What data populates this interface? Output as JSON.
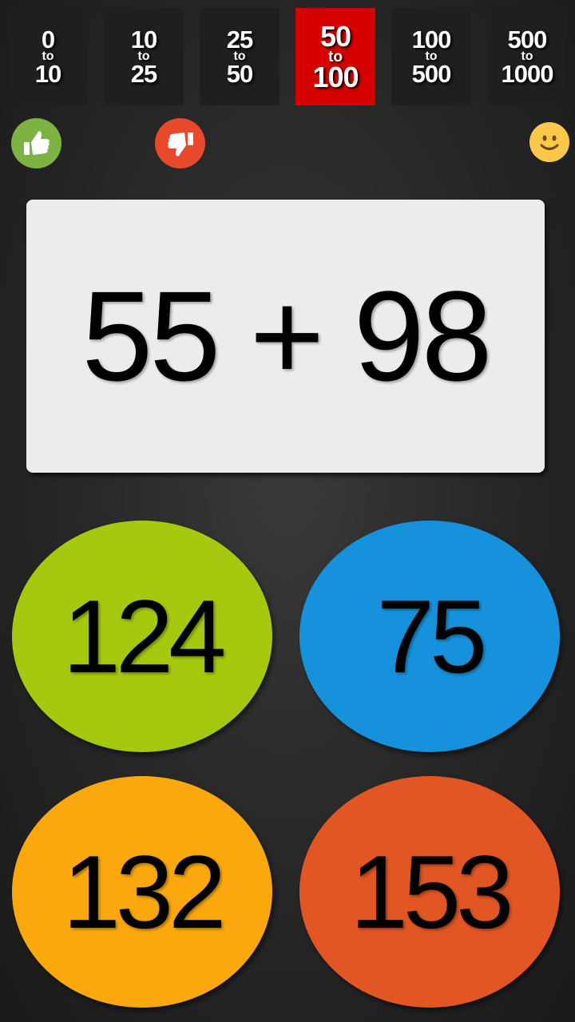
{
  "ranges": [
    {
      "from": "0",
      "to_label": "to",
      "to": "10",
      "active": false
    },
    {
      "from": "10",
      "to_label": "to",
      "to": "25",
      "active": false
    },
    {
      "from": "25",
      "to_label": "to",
      "to": "50",
      "active": false
    },
    {
      "from": "50",
      "to_label": "to",
      "to": "100",
      "active": true
    },
    {
      "from": "100",
      "to_label": "to",
      "to": "500",
      "active": false
    },
    {
      "from": "500",
      "to_label": "to",
      "to": "1000",
      "active": false
    }
  ],
  "icons": {
    "correct": "thumbs-up-icon",
    "wrong": "thumbs-down-icon",
    "mood": "smiley-icon"
  },
  "question": "55 + 98",
  "answers": [
    {
      "value": "124",
      "color": "#a5c90f"
    },
    {
      "value": "75",
      "color": "#1592db"
    },
    {
      "value": "132",
      "color": "#fba80e"
    },
    {
      "value": "153",
      "color": "#e15623"
    }
  ],
  "colors": {
    "active_tab": "#d70000",
    "thumbs_up": "#7cb342",
    "thumbs_down": "#e64a2a",
    "smiley": "#fbc84c"
  }
}
